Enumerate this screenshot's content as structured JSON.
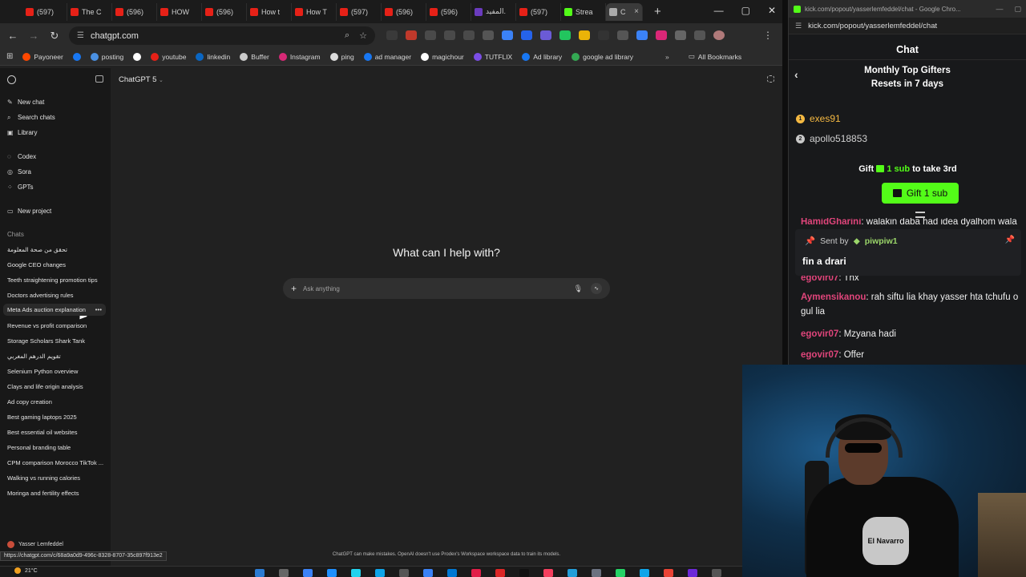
{
  "tabs": [
    {
      "label": "(597)",
      "color": "#e62117"
    },
    {
      "label": "The C",
      "color": "#e62117"
    },
    {
      "label": "(596)",
      "color": "#e62117"
    },
    {
      "label": "HOW",
      "color": "#e62117"
    },
    {
      "label": "(596)",
      "color": "#e62117"
    },
    {
      "label": "How t",
      "color": "#e62117"
    },
    {
      "label": "How T",
      "color": "#e62117"
    },
    {
      "label": "(597)",
      "color": "#e62117"
    },
    {
      "label": "(596)",
      "color": "#e62117"
    },
    {
      "label": "(596)",
      "color": "#e62117"
    },
    {
      "label": "المفيد.",
      "color": "#6a3bbd"
    },
    {
      "label": "(597)",
      "color": "#e62117"
    },
    {
      "label": "Strea",
      "color": "#53fc18"
    },
    {
      "label": "C",
      "color": "#aaaaaa",
      "active": true
    }
  ],
  "address": {
    "url": "chatgpt.com"
  },
  "bookmarks": [
    {
      "label": "Payoneer",
      "color": "#ff4800"
    },
    {
      "label": "",
      "color": "#1877f2"
    },
    {
      "label": "posting",
      "color": "#4a90e2"
    },
    {
      "label": "",
      "color": "#ffffff"
    },
    {
      "label": "youtube",
      "color": "#e62117"
    },
    {
      "label": "linkedin",
      "color": "#0a66c2"
    },
    {
      "label": "Buffer",
      "color": "#cccccc"
    },
    {
      "label": "Instagram",
      "color": "#d62976"
    },
    {
      "label": "ping",
      "color": "#dddddd"
    },
    {
      "label": "ad manager",
      "color": "#1877f2"
    },
    {
      "label": "magichour",
      "color": "#ffffff"
    },
    {
      "label": "TUTFLIX",
      "color": "#7b4ee6"
    },
    {
      "label": "Ad library",
      "color": "#1877f2"
    },
    {
      "label": "google ad library",
      "color": "#34a853"
    }
  ],
  "all_bookmarks": "All Bookmarks",
  "sidebar": {
    "top_items": [
      {
        "label": "New chat",
        "icon": "new-chat-icon",
        "glyph": "✎"
      },
      {
        "label": "Search chats",
        "icon": "search-icon",
        "glyph": "⌕"
      },
      {
        "label": "Library",
        "icon": "library-icon",
        "glyph": "▣"
      }
    ],
    "tool_items": [
      {
        "label": "Codex",
        "icon": "codex-icon",
        "glyph": "◌"
      },
      {
        "label": "Sora",
        "icon": "sora-icon",
        "glyph": "◎"
      },
      {
        "label": "GPTs",
        "icon": "gpts-icon",
        "glyph": "⁘"
      }
    ],
    "new_project": "New project",
    "chats_label": "Chats",
    "chats": [
      "تحقق من صحة المعلومة",
      "Google CEO changes",
      "Teeth straightening promotion tips",
      "Doctors advertising rules",
      "Meta Ads auction explanation",
      "Revenue vs profit comparison",
      "Storage Scholars Shark Tank",
      "تقويم الدرهم المغربي",
      "Selenium Python overview",
      "Clays and life origin analysis",
      "Ad copy creation",
      "Best gaming laptops 2025",
      "Best essential oil websites",
      "Personal branding table",
      "CPM comparison Morocco TikTok ...",
      "Walking vs running calories",
      "Moringa and fertility effects"
    ],
    "user_name": "Yasser Lemfeddel"
  },
  "main": {
    "model": "ChatGPT 5",
    "hero": "What can I help with?",
    "composer_placeholder": "Ask anything",
    "disclaimer": "ChatGPT can make mistakes. OpenAI doesn't use Prodex's Workspace workspace data to train its models."
  },
  "status_url": "https://chatgpt.com/c/68a9a0d9-496c-8328-8707-35c897f913e2",
  "popup": {
    "title_url": "kick.com/popout/yasserlemfeddel/chat - Google Chro...",
    "url": "kick.com/popout/yasserlemfeddel/chat",
    "chat_title": "Chat",
    "gifters_title": "Monthly Top Gifters",
    "gifters_reset": "Resets in 7 days",
    "gifters": [
      {
        "rank": "1",
        "name": "exes91",
        "color": "#f5b942"
      },
      {
        "rank": "2",
        "name": "apollo518853",
        "color": "#c9c9c9"
      }
    ],
    "gift_prefix": "Gift",
    "gift_amount": "1 sub",
    "gift_suffix": "to take 3rd",
    "gift_button": "Gift 1 sub",
    "pinned": {
      "sent_by": "Sent by",
      "sender": "piwpiw1",
      "text": "fin a drari"
    },
    "messages": [
      {
        "user": "HamidGharini",
        "text": ": walakin daba had idea dyalhom wala",
        "color": "#e0457b"
      },
      {
        "user": "egovir07",
        "text": ": Thx",
        "color": "#e0457b"
      },
      {
        "user": "Aymensikanou",
        "text": ": rah siftu lia khay yasser hta tchufu o gul lia",
        "color": "#e0457b"
      },
      {
        "user": "egovir07",
        "text": ": Mzyana hadi",
        "color": "#e0457b"
      },
      {
        "user": "egovir07",
        "text": ": Offer",
        "color": "#e0457b"
      }
    ]
  },
  "webcam": {
    "shirt_print": "El Navarro"
  },
  "taskbar": {
    "temperature": "21°C"
  }
}
